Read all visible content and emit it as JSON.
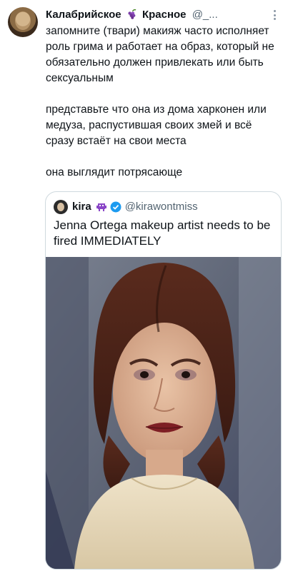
{
  "tweet": {
    "author_name": "Калабрийское",
    "author_name_2": "Красное",
    "author_handle": "@_...",
    "paragraphs": [
      "запомните (твари) макияж часто исполняет роль грима и работает на образ, который не обязательно должен привлекать или быть сексуальным",
      "представьте что она из дома харконен или медуза, распустившая своих змей и всё сразу встаёт на свои места",
      "она выглядит потрясающе"
    ]
  },
  "quote": {
    "author_name": "kira",
    "author_handle": "@kirawontmiss",
    "text": "Jenna Ortega makeup artist needs to be fired IMMEDIATELY"
  },
  "icons": {
    "author_emoji": "grapes-icon",
    "quote_emoji": "alien-monster-icon",
    "verified": "verified-badge-icon",
    "more": "more-dots-icon"
  },
  "colors": {
    "text": "#0f1419",
    "secondary": "#536471",
    "border": "#cfd9de",
    "verified": "#1d9bf0"
  }
}
